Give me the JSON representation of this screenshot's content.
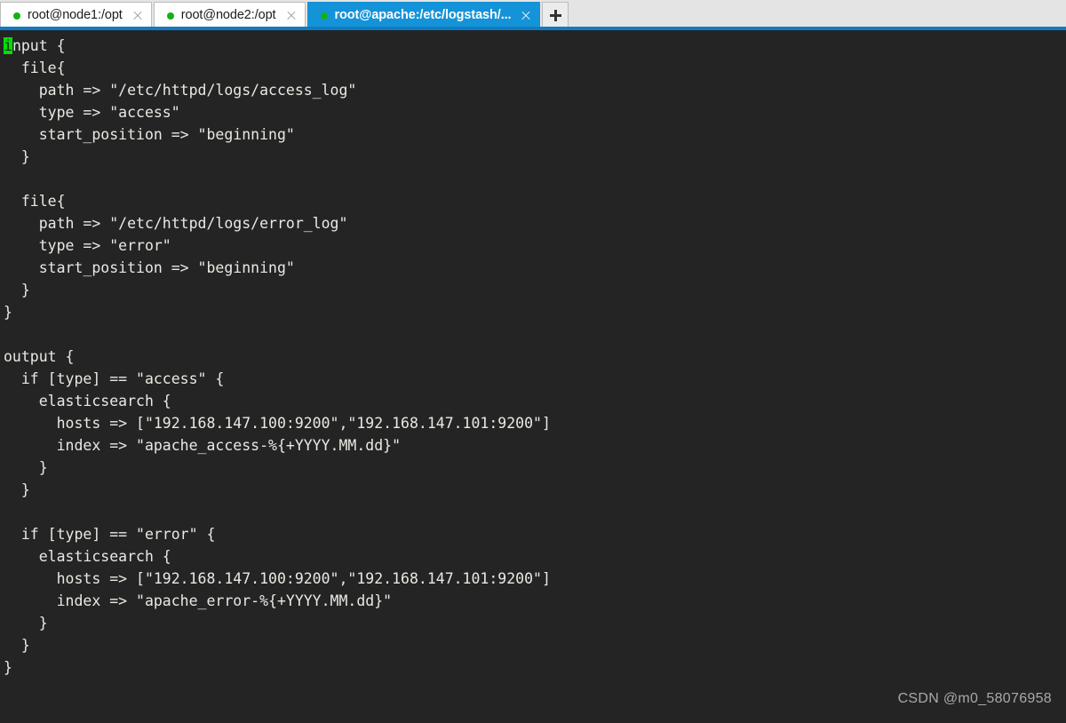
{
  "window": {
    "app": "terminal-emulator",
    "accent_color": "#0d7cc4",
    "active_tab_color": "#1593d8",
    "terminal_background": "#242424",
    "terminal_foreground": "#e9e9e3",
    "cursor_color": "#00e000"
  },
  "tabs": [
    {
      "label": "root@node1:/opt",
      "active": false,
      "status_dot": "connected-dot",
      "close_label": "close-tab-icon"
    },
    {
      "label": "root@node2:/opt",
      "active": false,
      "status_dot": "connected-dot",
      "close_label": "close-tab-icon"
    },
    {
      "label": "root@apache:/etc/logstash/...",
      "active": true,
      "status_dot": "connected-dot",
      "close_label": "close-tab-icon"
    }
  ],
  "new_tab_button": {
    "label": "+",
    "name": "new-tab-button"
  },
  "terminal": {
    "cursor": {
      "char": "i",
      "row": 0,
      "col": 0
    },
    "lines": [
      "input {",
      "  file{",
      "    path => \"/etc/httpd/logs/access_log\"",
      "    type => \"access\"",
      "    start_position => \"beginning\"",
      "  }",
      "",
      "  file{",
      "    path => \"/etc/httpd/logs/error_log\"",
      "    type => \"error\"",
      "    start_position => \"beginning\"",
      "  }",
      "}",
      "",
      "output {",
      "  if [type] == \"access\" {",
      "    elasticsearch {",
      "      hosts => [\"192.168.147.100:9200\",\"192.168.147.101:9200\"]",
      "      index => \"apache_access-%{+YYYY.MM.dd}\"",
      "    }",
      "  }",
      "",
      "  if [type] == \"error\" {",
      "    elasticsearch {",
      "      hosts => [\"192.168.147.100:9200\",\"192.168.147.101:9200\"]",
      "      index => \"apache_error-%{+YYYY.MM.dd}\"",
      "    }",
      "  }",
      "}"
    ]
  },
  "watermark": {
    "text": "CSDN @m0_58076958"
  }
}
